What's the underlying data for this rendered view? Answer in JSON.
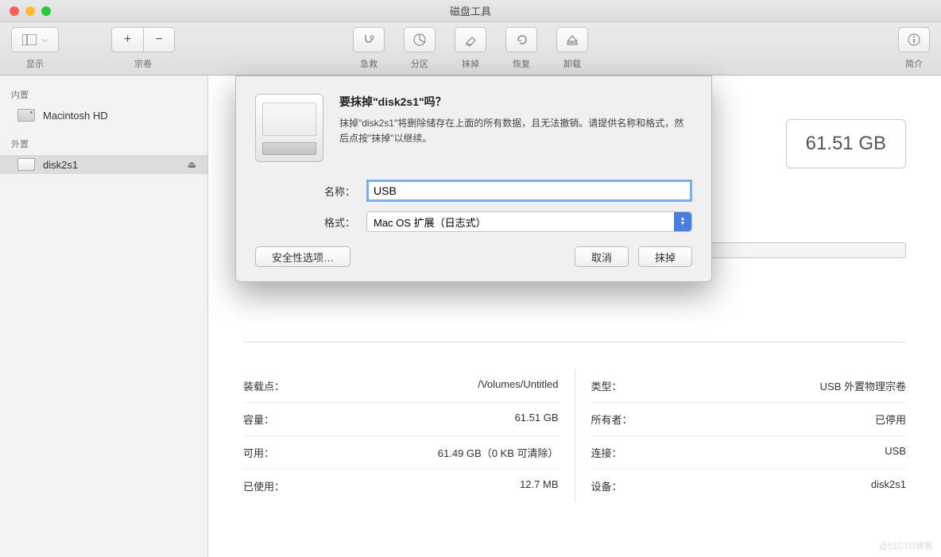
{
  "window": {
    "title": "磁盘工具"
  },
  "toolbar": {
    "display": "显示",
    "volume": "宗卷",
    "firstaid": "急救",
    "partition": "分区",
    "erase": "抹掉",
    "restore": "恢复",
    "unmount": "卸载",
    "info": "简介"
  },
  "sidebar": {
    "internal_h": "内置",
    "internal_item": "Macintosh HD",
    "external_h": "外置",
    "external_item": "disk2s1"
  },
  "sizebox": {
    "value": "61.51 GB"
  },
  "info": {
    "left": [
      {
        "k": "装载点：",
        "v": "/Volumes/Untitled"
      },
      {
        "k": "容量：",
        "v": "61.51 GB"
      },
      {
        "k": "可用：",
        "v": "61.49 GB（0 KB 可清除）"
      },
      {
        "k": "已使用：",
        "v": "12.7 MB"
      }
    ],
    "right": [
      {
        "k": "类型：",
        "v": "USB 外置物理宗卷"
      },
      {
        "k": "所有者：",
        "v": "已停用"
      },
      {
        "k": "连接：",
        "v": "USB"
      },
      {
        "k": "设备：",
        "v": "disk2s1"
      }
    ]
  },
  "modal": {
    "title": "要抹掉\"disk2s1\"吗？",
    "desc": "抹掉\"disk2s1\"将删除储存在上面的所有数据，且无法撤销。请提供名称和格式，然后点按\"抹掉\"以继续。",
    "name_label": "名称：",
    "name_value": "USB",
    "format_label": "格式：",
    "format_value": "Mac OS 扩展（日志式）",
    "security": "安全性选项…",
    "cancel": "取消",
    "erase": "抹掉"
  },
  "watermark": "@51CTO博客"
}
